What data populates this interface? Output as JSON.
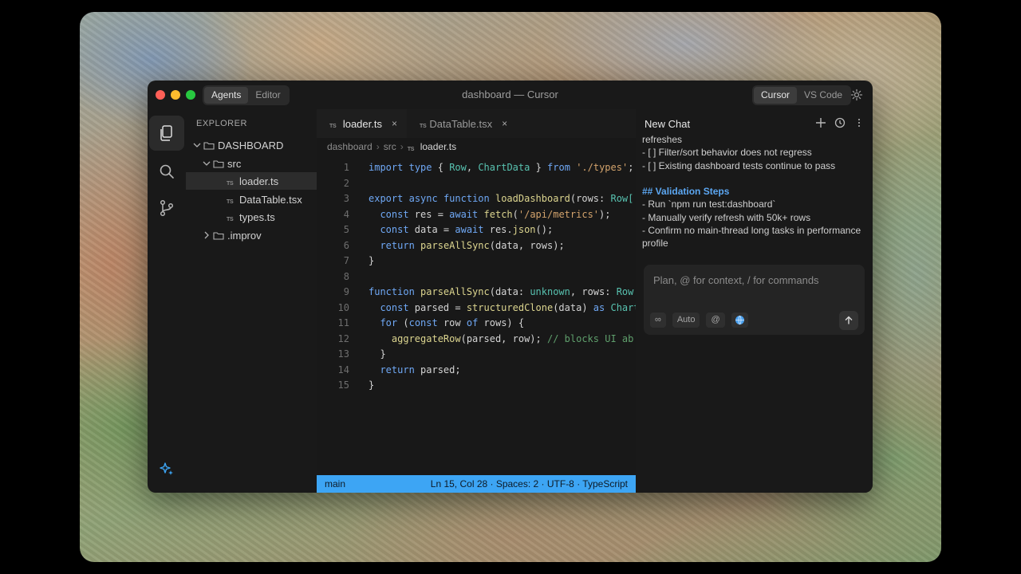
{
  "window": {
    "title": "dashboard — Cursor"
  },
  "modes": {
    "agents": "Agents",
    "editor": "Editor"
  },
  "ide_switch": {
    "cursor": "Cursor",
    "vscode": "VS Code"
  },
  "colors": {
    "accent": "#3da5f4",
    "close": "#ff5f57",
    "minimize": "#febc2e",
    "zoom": "#28c840"
  },
  "explorer": {
    "header": "EXPLORER",
    "root": "DASHBOARD",
    "items": [
      {
        "label": "src"
      },
      {
        "label": "loader.ts",
        "badge": "TS"
      },
      {
        "label": "DataTable.tsx",
        "badge": "TS"
      },
      {
        "label": "types.ts",
        "badge": "TS"
      },
      {
        "label": ".improv"
      }
    ]
  },
  "tabs": [
    {
      "label": "loader.ts",
      "badge": "TS",
      "close": "×"
    },
    {
      "label": "DataTable.tsx",
      "badge": "TS",
      "close": "×"
    }
  ],
  "breadcrumb": {
    "root": "dashboard",
    "folder": "src",
    "file": "loader.ts",
    "badge": "TS",
    "sep": "›"
  },
  "code": {
    "line_numbers": [
      "1",
      "2",
      "3",
      "4",
      "5",
      "6",
      "7",
      "8",
      "9",
      "10",
      "11",
      "12",
      "13",
      "14",
      "15"
    ],
    "l1": {
      "a": "import",
      "b": "type",
      "c": " { ",
      "d": "Row",
      "e": ", ",
      "f": "ChartData",
      "g": " } ",
      "h": "from",
      "i": " ",
      "j": "'./types'",
      "k": ";"
    },
    "l3": {
      "a": "export",
      "b": " ",
      "c": "async",
      "d": " ",
      "e": "function",
      "f": " ",
      "g": "loadDashboard",
      "h": "(rows: ",
      "i": "Row["
    },
    "l4": {
      "a": "  ",
      "b": "const",
      "c": " res = ",
      "d": "await",
      "e": " ",
      "f": "fetch",
      "g": "(",
      "h": "'/api/metrics'",
      "i": ");"
    },
    "l5": {
      "a": "  ",
      "b": "const",
      "c": " data = ",
      "d": "await",
      "e": " res.",
      "f": "json",
      "g": "();"
    },
    "l6": {
      "a": "  ",
      "b": "return",
      "c": " ",
      "d": "parseAllSync",
      "e": "(data, rows);"
    },
    "l7": {
      "a": "}"
    },
    "l9": {
      "a": "function",
      "b": " ",
      "c": "parseAllSync",
      "d": "(data: ",
      "e": "unknown",
      "f": ", rows: ",
      "g": "Row"
    },
    "l10": {
      "a": "  ",
      "b": "const",
      "c": " parsed = ",
      "d": "structuredClone",
      "e": "(data) ",
      "f": "as",
      "g": " ",
      "h": "Chart"
    },
    "l11": {
      "a": "  ",
      "b": "for",
      "c": " (",
      "d": "const",
      "e": " row ",
      "f": "of",
      "g": " rows) {"
    },
    "l12": {
      "a": "    ",
      "b": "aggregateRow",
      "c": "(parsed, row); ",
      "d": "// blocks UI ab"
    },
    "l13": {
      "a": "  }"
    },
    "l14": {
      "a": "  ",
      "b": "return",
      "c": " parsed;"
    },
    "l15": {
      "a": "}"
    }
  },
  "status": {
    "branch": "main",
    "info": "Ln 15, Col 28 · Spaces: 2 · UTF-8 · TypeScript"
  },
  "chat": {
    "title": "New Chat",
    "lines": [
      "refreshes",
      "- [ ] Filter/sort behavior does not regress",
      "- [ ] Existing dashboard tests continue to pass"
    ],
    "validation_heading": "## Validation Steps",
    "validation_lines": [
      "- Run `npm run test:dashboard`",
      "- Manually verify refresh with 50k+ rows",
      "- Confirm no main-thread long tasks in performance profile"
    ],
    "input_placeholder": "Plan, @ for context, / for commands",
    "pills": {
      "infinity": "∞",
      "auto": "Auto",
      "at": "@"
    }
  }
}
